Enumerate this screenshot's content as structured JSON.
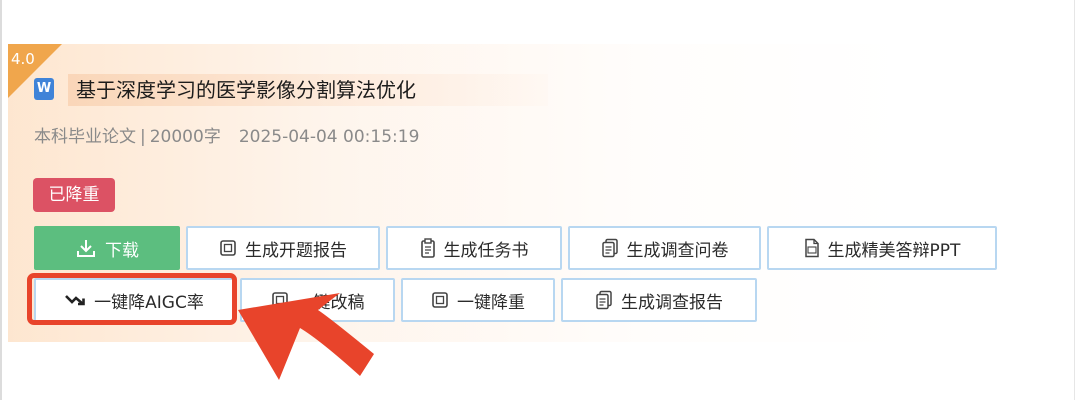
{
  "version": "4.0",
  "document": {
    "icon_letter": "W",
    "title": "基于深度学习的医学影像分割算法优化",
    "type": "本科毕业论文",
    "separator": "|",
    "word_count": "20000字",
    "timestamp": "2025-04-04 00:15:19"
  },
  "status_badge": "已降重",
  "actions_row1": {
    "download": "下载",
    "opening_report": "生成开题报告",
    "task_book": "生成任务书",
    "questionnaire": "生成调查问卷",
    "defense_ppt": "生成精美答辩PPT"
  },
  "actions_row2": {
    "reduce_aigc": "一键降AIGC率",
    "rewrite": "一键改稿",
    "reduce_dup": "一键降重",
    "survey_report": "生成调查报告"
  },
  "icons": {
    "download": "download-icon",
    "report": "document-icon",
    "clipboard": "clipboard-icon",
    "pages": "pages-icon",
    "ppt": "ppt-file-icon",
    "trend": "trend-down-icon"
  },
  "colors": {
    "download_green": "#5cbe7f",
    "badge_red": "#dc5264",
    "version_orange": "#f0a64c",
    "highlight_red": "#e8442b",
    "button_border": "#b8d7f1"
  }
}
